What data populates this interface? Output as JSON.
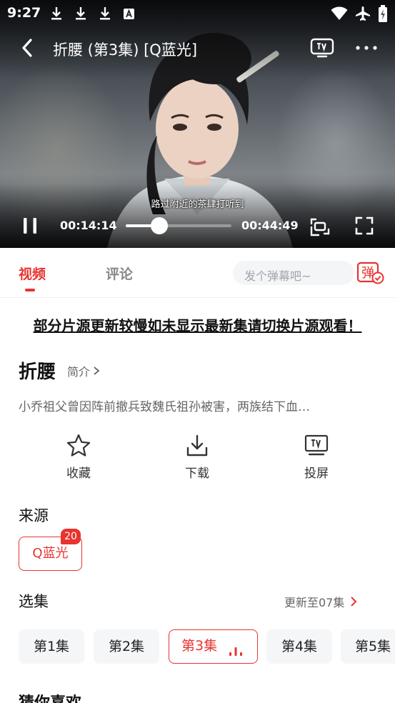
{
  "status_bar": {
    "time": "9:27",
    "notification_icons": [
      "download-icon",
      "download-icon",
      "download-icon",
      "text-a-icon"
    ],
    "right_icons": [
      "wifi-icon",
      "airplane-icon",
      "battery-charging-icon"
    ]
  },
  "player": {
    "title": "折腰 (第3集) [Q蓝光]",
    "subtitle": "路过附近的茶肆打听到",
    "current_time": "00:14:14",
    "duration": "00:44:49",
    "progress_fraction": 0.318,
    "controls": [
      "back-icon",
      "tv-icon",
      "more-icon",
      "pause-icon",
      "rotate-icon",
      "fullscreen-icon"
    ]
  },
  "tabs": {
    "video": "视频",
    "comment": "评论",
    "danmu_placeholder": "发个弹幕吧~",
    "danmu_button_glyph": "弹",
    "accent_color": "#e8332f"
  },
  "notice": "部分片源更新较慢如未显示最新集请切换片源观看！",
  "show": {
    "title": "折腰",
    "intro_link": "简介",
    "synopsis": "小乔祖父曾因阵前撤兵致魏氏祖孙被害，两族结下血…"
  },
  "actions": [
    {
      "label": "收藏",
      "icon": "star-icon"
    },
    {
      "label": "下载",
      "icon": "download-icon"
    },
    {
      "label": "投屏",
      "icon": "tv-icon"
    }
  ],
  "source": {
    "title": "来源",
    "chip_label": "Q蓝光",
    "badge_count": "20"
  },
  "episodes": {
    "title": "选集",
    "update_text": "更新至07集",
    "items": [
      "第1集",
      "第2集",
      "第3集",
      "第4集",
      "第5集"
    ],
    "active_index": 2
  },
  "recommend_title": "猜你喜欢"
}
